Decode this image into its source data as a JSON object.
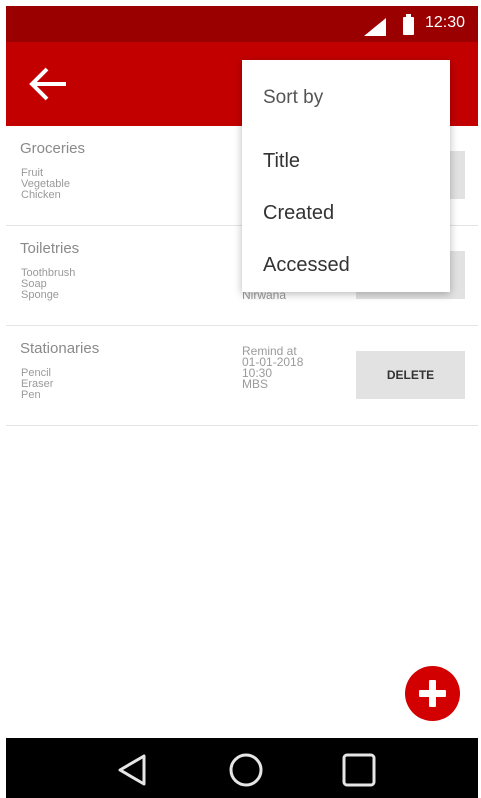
{
  "status_bar": {
    "time": "12:30"
  },
  "lists": [
    {
      "title": "Groceries",
      "items": [
        "Fruit",
        "Vegetable",
        "Chicken"
      ]
    },
    {
      "title": "Toiletries",
      "items": [
        "Toothbrush",
        "Soap",
        "Sponge"
      ],
      "remind_visible": [
        "Nirwana"
      ]
    },
    {
      "title": "Stationaries",
      "items": [
        "Pencil",
        "Eraser",
        "Pen"
      ],
      "remind": [
        "Remind at",
        "01-01-2018",
        "10:30",
        "MBS"
      ],
      "delete_label": "DELETE"
    }
  ],
  "sort_menu": {
    "header": "Sort by",
    "options": [
      "Title",
      "Created",
      "Accessed"
    ]
  },
  "colors": {
    "status_bar": "#9b0000",
    "app_bar": "#c30000",
    "fab": "#d20000"
  },
  "icons": {
    "back": "arrow-left-icon",
    "fab": "plus-icon",
    "nav": [
      "back-triangle-icon",
      "home-circle-icon",
      "recents-square-icon"
    ]
  }
}
